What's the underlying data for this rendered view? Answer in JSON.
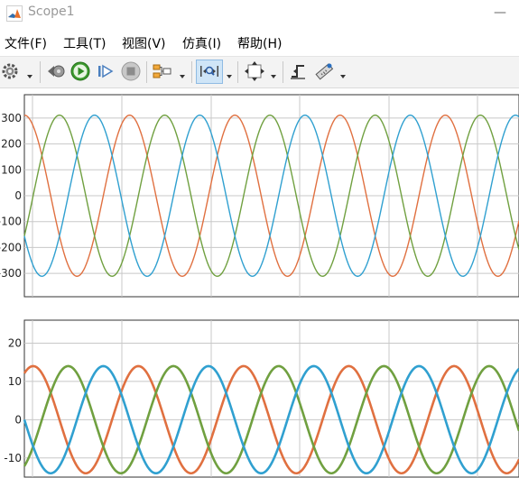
{
  "window": {
    "title": "Scope1"
  },
  "menu": [
    "文件(F)",
    "工具(T)",
    "视图(V)",
    "仿真(I)",
    "帮助(H)"
  ],
  "colors": {
    "phase_a": "#e07040",
    "phase_b": "#70a040",
    "phase_c": "#30a0d0"
  },
  "toolbar": {
    "icons": [
      "gear-icon",
      "step-back-icon",
      "run-icon",
      "step-forward-icon",
      "stop-icon",
      "signal-select-icon",
      "zoom-axes-icon",
      "fit-to-view-icon",
      "triggers-icon",
      "measure-icon"
    ]
  },
  "chart_data": [
    {
      "type": "line",
      "title": "",
      "xlabel": "",
      "ylabel": "",
      "ylim": [
        -390,
        390
      ],
      "yticks": [
        "300",
        "200",
        "100",
        "0",
        "-100",
        "-200",
        "-300"
      ],
      "ytick_values": [
        300,
        200,
        100,
        0,
        -100,
        -200,
        -300
      ],
      "grid": true,
      "series": [
        {
          "color": "#e07040",
          "amplitude": 311,
          "phase_deg": 90,
          "cycles": 4.7
        },
        {
          "color": "#70a040",
          "amplitude": 311,
          "phase_deg": -30,
          "cycles": 4.7
        },
        {
          "color": "#30a0d0",
          "amplitude": 311,
          "phase_deg": 210,
          "cycles": 4.7
        }
      ]
    },
    {
      "type": "line",
      "title": "",
      "xlabel": "",
      "ylabel": "",
      "ylim": [
        -15,
        26
      ],
      "yticks": [
        "20",
        "10",
        "0",
        "-10"
      ],
      "ytick_values": [
        20,
        10,
        0,
        -10
      ],
      "grid": true,
      "series": [
        {
          "color": "#e07040",
          "amplitude": 14,
          "phase_deg": 60,
          "cycles": 4.7
        },
        {
          "color": "#70a040",
          "amplitude": 14,
          "phase_deg": -60,
          "cycles": 4.7
        },
        {
          "color": "#30a0d0",
          "amplitude": 14,
          "phase_deg": 180,
          "cycles": 4.7
        }
      ]
    }
  ]
}
